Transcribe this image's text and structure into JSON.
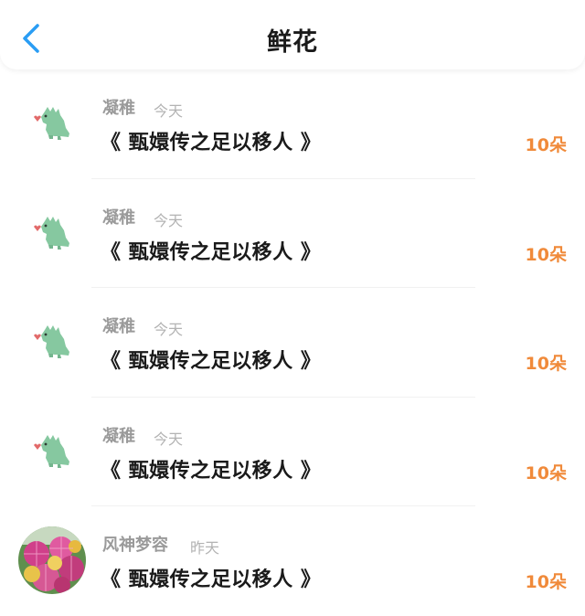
{
  "header": {
    "title": "鲜花",
    "back_icon": "chevron-left-icon",
    "accent_color": "#2a9df4"
  },
  "gift_color": "#f08a3a",
  "items": [
    {
      "avatar": "dinosaur-avatar",
      "name": "凝稚",
      "time": "今天",
      "work": "《 甄嬛传之足以移人 》",
      "count": "10朵"
    },
    {
      "avatar": "dinosaur-avatar",
      "name": "凝稚",
      "time": "今天",
      "work": "《 甄嬛传之足以移人 》",
      "count": "10朵"
    },
    {
      "avatar": "dinosaur-avatar",
      "name": "凝稚",
      "time": "今天",
      "work": "《 甄嬛传之足以移人 》",
      "count": "10朵"
    },
    {
      "avatar": "dinosaur-avatar",
      "name": "凝稚",
      "time": "今天",
      "work": "《 甄嬛传之足以移人 》",
      "count": "10朵"
    },
    {
      "avatar": "flower-photo-avatar",
      "name": "风神梦容",
      "time": "昨天",
      "work": "《 甄嬛传之足以移人 》",
      "count": "10朵"
    }
  ]
}
